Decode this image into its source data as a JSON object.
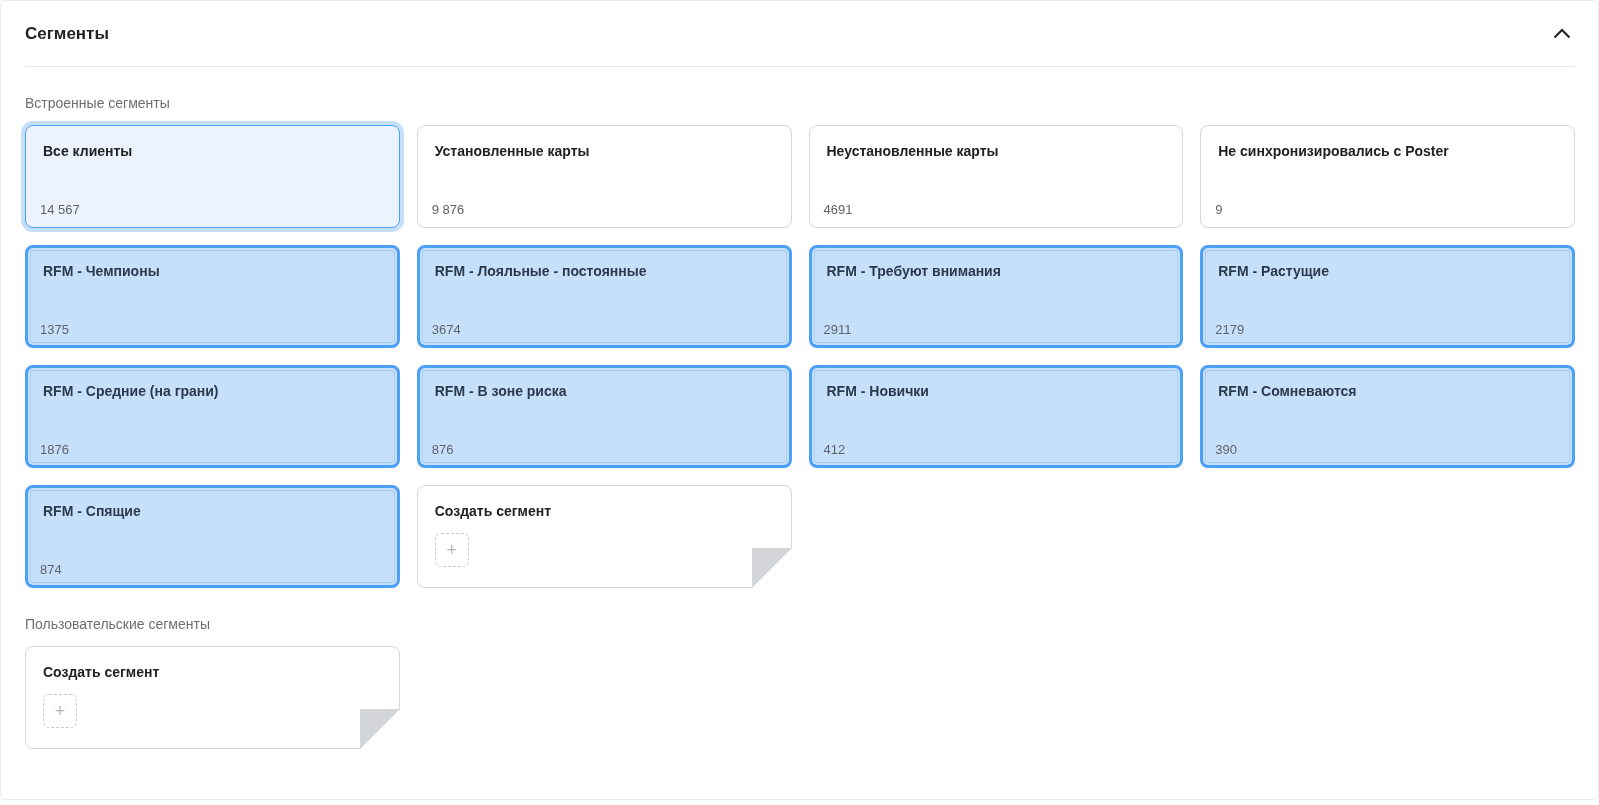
{
  "panel": {
    "title": "Сегменты",
    "expanded": true
  },
  "sections": [
    {
      "label": "Встроенные сегменты",
      "cards": [
        {
          "kind": "active",
          "title": "Все клиенты",
          "count": "14 567"
        },
        {
          "kind": "plain",
          "title": "Установленные карты",
          "count": "9 876"
        },
        {
          "kind": "plain",
          "title": "Неустановленные карты",
          "count": "4691"
        },
        {
          "kind": "plain",
          "title": "Не синхронизировались с Poster",
          "count": "9"
        },
        {
          "kind": "highlighted",
          "title": "RFM - Чемпионы",
          "count": "1375"
        },
        {
          "kind": "highlighted",
          "title": "RFM - Лояльные - постоянные",
          "count": "3674"
        },
        {
          "kind": "highlighted",
          "title": "RFM - Требуют внимания",
          "count": "2911"
        },
        {
          "kind": "highlighted",
          "title": "RFM - Растущие",
          "count": "2179"
        },
        {
          "kind": "highlighted",
          "title": "RFM - Средние (на грани)",
          "count": "1876"
        },
        {
          "kind": "highlighted",
          "title": "RFM - В зоне риска",
          "count": "876"
        },
        {
          "kind": "highlighted",
          "title": "RFM - Новички",
          "count": "412"
        },
        {
          "kind": "highlighted",
          "title": "RFM - Сомневаются",
          "count": "390"
        },
        {
          "kind": "highlighted",
          "title": "RFM - Спящие",
          "count": "874"
        },
        {
          "kind": "create",
          "title": "Создать сегмент",
          "action": "+"
        }
      ]
    },
    {
      "label": "Пользовательские сегменты",
      "cards": [
        {
          "kind": "create",
          "title": "Создать сегмент",
          "action": "+"
        }
      ]
    }
  ]
}
